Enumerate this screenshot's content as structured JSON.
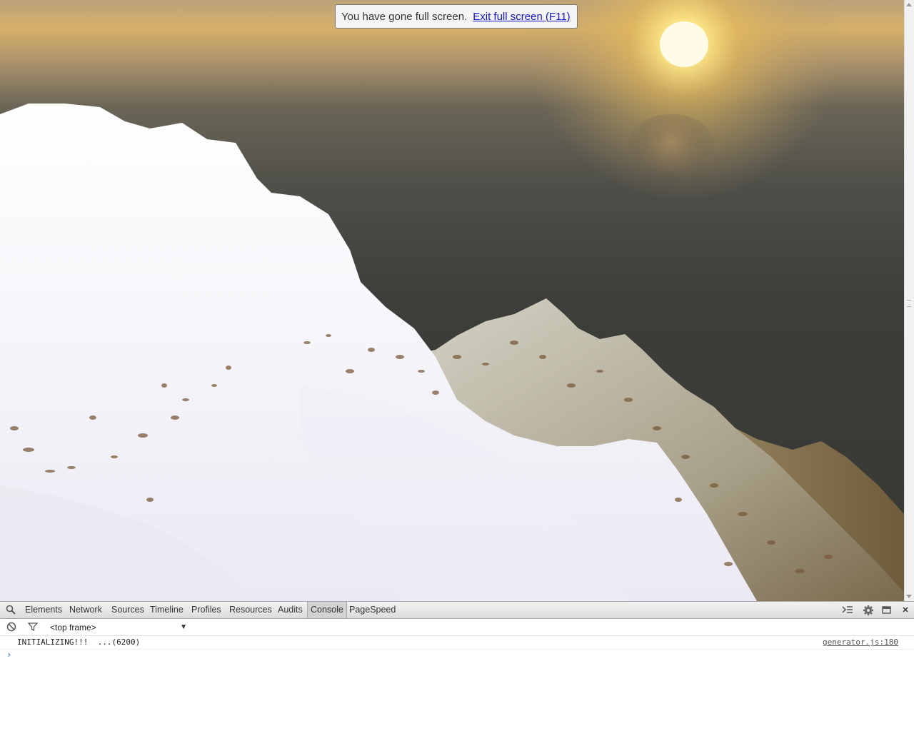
{
  "fullscreen_bubble": {
    "message": "You have gone full screen.",
    "exit_link": "Exit full screen (F11)"
  },
  "devtools": {
    "tabs": [
      "Elements",
      "Network",
      "Sources",
      "Timeline",
      "Profiles",
      "Resources",
      "Audits",
      "Console",
      "PageSpeed"
    ],
    "active_tab": "Console",
    "frame_selector": "<top frame>",
    "console_messages": [
      {
        "text": "INITIALIZING!!!  ...(6200)",
        "source": "generator.js:180"
      }
    ],
    "icons": {
      "search": "search-icon",
      "execute": "console-drawer-icon",
      "settings": "gear-icon",
      "dock": "dock-icon",
      "close": "close-icon",
      "clear": "clear-console-icon",
      "filter": "filter-icon"
    }
  },
  "colors": {
    "sky_top": "#bba27a",
    "sun": "#fff6c0",
    "sea": "#373834",
    "snow": "#f6f5fa",
    "rock": "#8a7452",
    "link": "#1515c8"
  }
}
